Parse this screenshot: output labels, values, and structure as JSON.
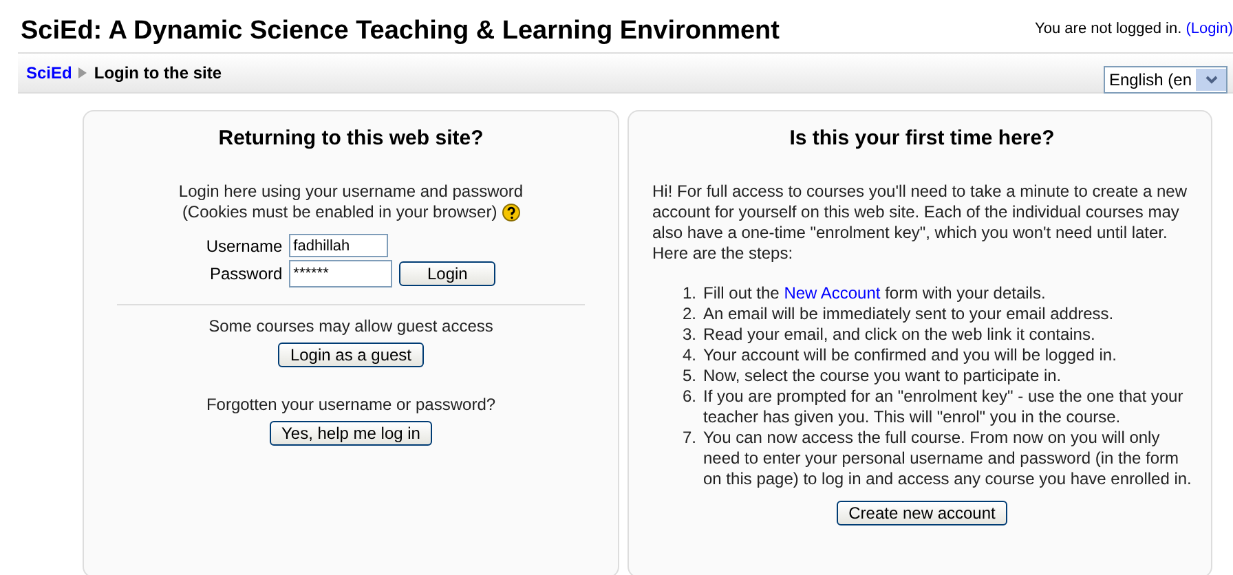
{
  "header": {
    "title": "SciEd: A Dynamic Science Teaching & Learning Environment",
    "login_info": "You are not logged in.",
    "login_link": "(Login)"
  },
  "navbar": {
    "breadcrumb": [
      {
        "label": "SciEd",
        "kind": "link"
      },
      {
        "label": "Login to the site",
        "kind": "current"
      }
    ],
    "language": "English (en"
  },
  "login_panel": {
    "heading": "Returning to this web site?",
    "intro": [
      "Login here using your username and password",
      "(Cookies must be enabled in your browser)"
    ],
    "username": {
      "label": "Username",
      "value": "fadhillah"
    },
    "password": {
      "label": "Password",
      "value": "******"
    },
    "login_button": "Login",
    "guest_text": "Some courses may allow guest access",
    "guest_button": "Login as a guest",
    "forgot_text": "Forgotten your username or password?",
    "forgot_button": "Yes, help me log in"
  },
  "signup_panel": {
    "heading": "Is this your first time here?",
    "intro": "Hi! For full access to courses you'll need to take a minute to create a new account for yourself on this web site. Each of the individual courses may also have a one-time \"enrolment key\", which you won't need until later. Here are the steps:",
    "steps": [
      {
        "number": "1.",
        "before": "Fill out the ",
        "link": "New Account",
        "after": " form with your details."
      },
      {
        "number": "2.",
        "before": "An email will be immediately sent to your email address."
      },
      {
        "number": "3.",
        "before": "Read your email, and click on the web link it contains."
      },
      {
        "number": "4.",
        "before": "Your account will be confirmed and you will be logged in."
      },
      {
        "number": "5.",
        "before": "Now, select the course you want to participate in."
      },
      {
        "number": "6.",
        "before": "If you are prompted for an \"enrolment key\" - use the one that your teacher has given you. This will \"enrol\" you in the course."
      },
      {
        "number": "7.",
        "before": "You can now access the full course. From now on you will only need to enter your personal username and password (in the form on this page) to log in and access any course you have enrolled in."
      }
    ],
    "button": "Create new account"
  }
}
